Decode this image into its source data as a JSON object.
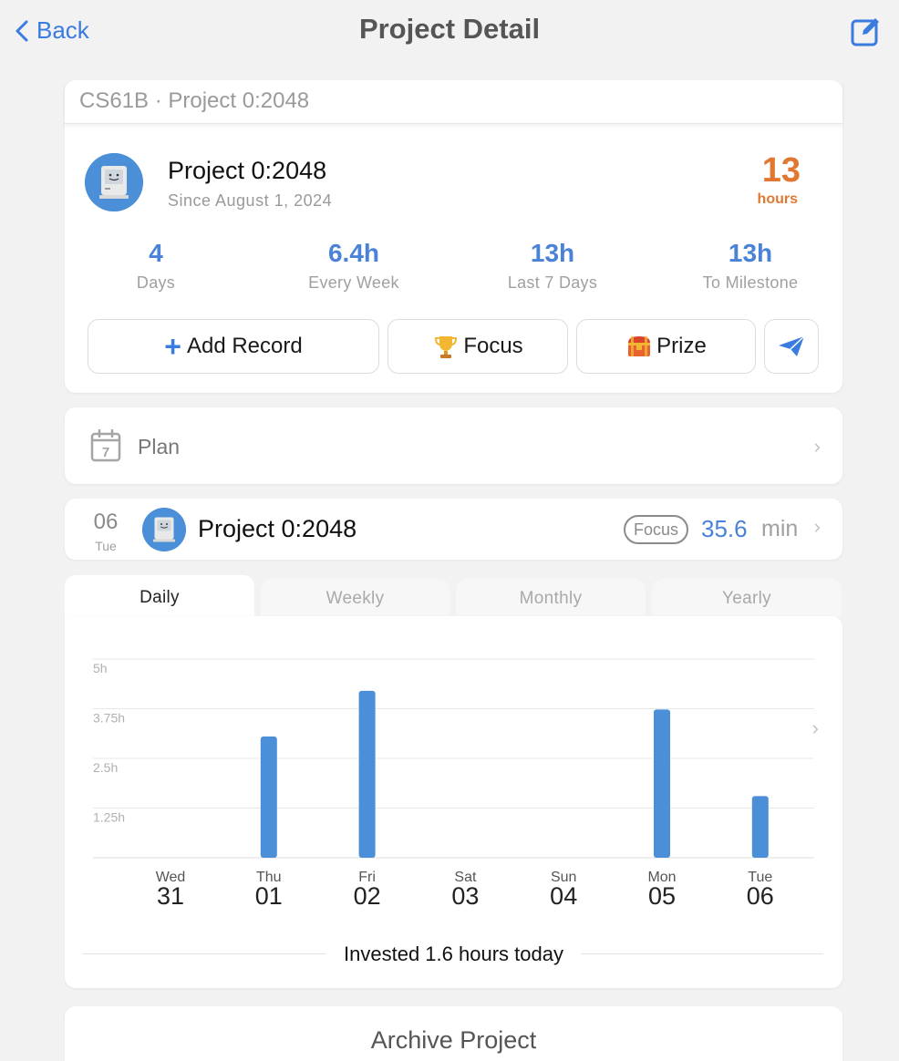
{
  "nav": {
    "back_label": "Back",
    "title": "Project Detail",
    "edit_icon": "square-pencil-icon"
  },
  "project": {
    "course_header": "CS61B · Project 0:2048",
    "name": "Project 0:2048",
    "since": "Since August 1, 2024",
    "hours_value": "13",
    "hours_unit": "hours",
    "accent": "#e07832"
  },
  "stats": [
    {
      "value": "4",
      "label": "Days"
    },
    {
      "value": "6.4h",
      "label": "Every Week"
    },
    {
      "value": "13h",
      "label": "Last 7 Days"
    },
    {
      "value": "13h",
      "label": "To Milestone"
    }
  ],
  "actions": {
    "add_record": "Add Record",
    "focus": "Focus",
    "prize": "Prize",
    "send_icon": "paper-plane-icon"
  },
  "plan": {
    "label": "Plan",
    "icon": "calendar-icon",
    "icon_day": "7"
  },
  "record": {
    "day": "06",
    "weekday": "Tue",
    "name": "Project 0:2048",
    "badge": "Focus",
    "value": "35.6",
    "unit": "min"
  },
  "tabs": [
    "Daily",
    "Weekly",
    "Monthly",
    "Yearly"
  ],
  "chart_data": {
    "type": "bar",
    "categories": [
      "Wed 31",
      "Thu 01",
      "Fri 02",
      "Sat 03",
      "Sun 04",
      "Mon 05",
      "Tue 06"
    ],
    "day_names": [
      "Wed",
      "Thu",
      "Fri",
      "Sat",
      "Sun",
      "Mon",
      "Tue"
    ],
    "day_nums": [
      "31",
      "01",
      "02",
      "03",
      "04",
      "05",
      "06"
    ],
    "values": [
      0,
      3.05,
      4.2,
      0,
      0,
      3.73,
      1.55
    ],
    "unit": "h",
    "ylim": [
      0,
      5
    ],
    "yticks": [
      1.25,
      2.5,
      3.75,
      5
    ],
    "ytick_labels": [
      "1.25h",
      "2.5h",
      "3.75h",
      "5h"
    ],
    "grid": true,
    "bar_color": "#4a8fd8"
  },
  "summary": "Invested 1.6 hours today",
  "archive_label": "Archive Project"
}
